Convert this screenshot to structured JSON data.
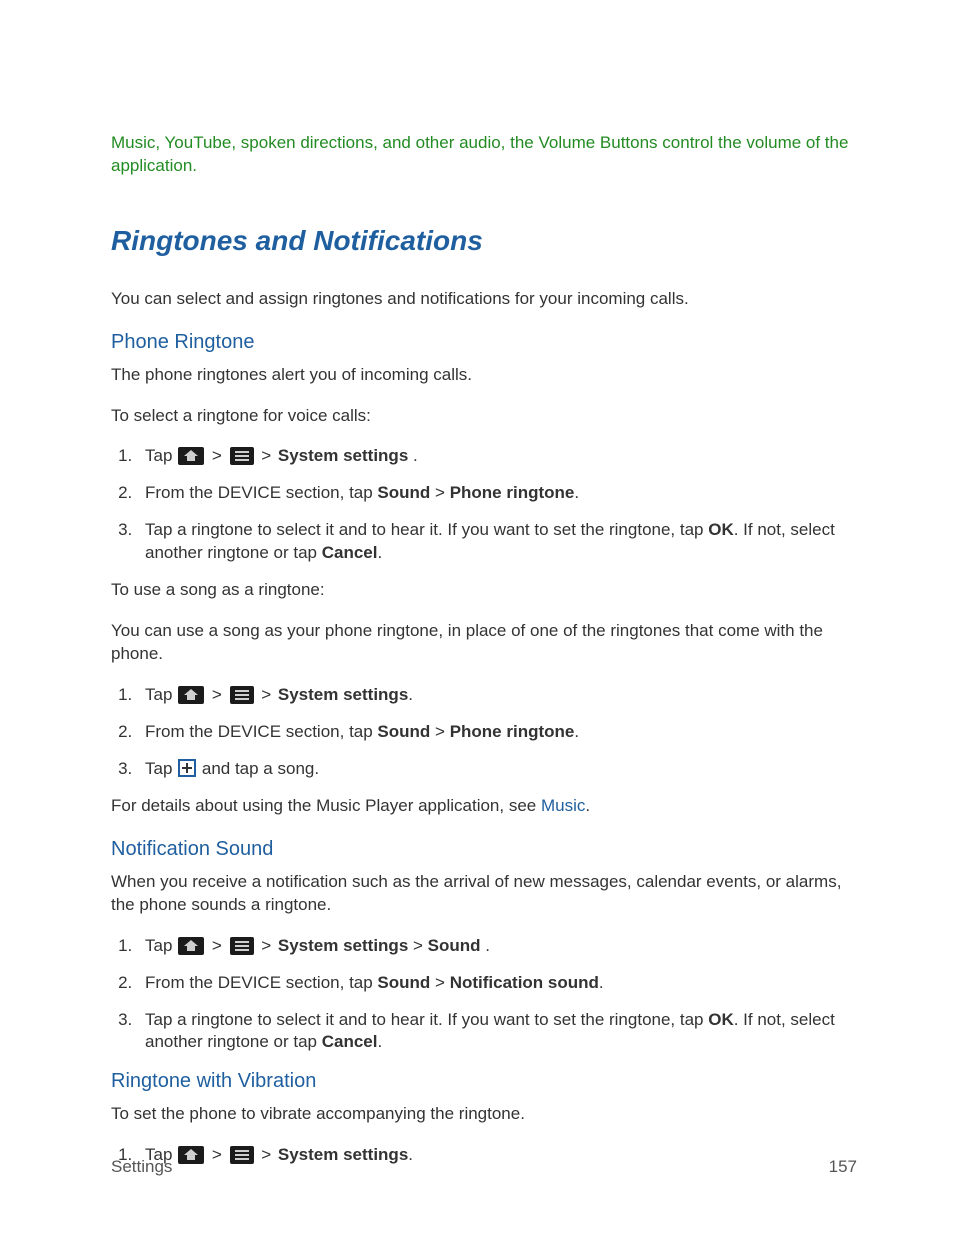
{
  "top_note": "Music, YouTube, spoken directions, and other audio, the Volume Buttons control the volume of the application.",
  "section_title": "Ringtones and Notifications",
  "section_intro": "You can select and assign ringtones and notifications for your incoming calls.",
  "phone_ringtone": {
    "title": "Phone Ringtone",
    "p1": "The phone ringtones alert you of incoming calls.",
    "p2": "To select a ringtone for voice calls:",
    "step1": {
      "tap": "Tap ",
      "sep": " > ",
      "system_settings": "System settings",
      "tail": " ."
    },
    "step2": {
      "lead": "From the DEVICE section, tap ",
      "sound": "Sound",
      "sep": " > ",
      "phone_ringtone": "Phone ringtone",
      "dot": "."
    },
    "step3": {
      "a": "Tap a ringtone to select it and to hear it. If you want to set the ringtone, tap ",
      "ok": "OK",
      "b": ". If not, select another ringtone or tap ",
      "cancel": "Cancel",
      "dot": "."
    },
    "p3": "To use a song as a ringtone:",
    "p4": "You can use a song as your phone ringtone, in place of one of the ringtones that come with the phone.",
    "step_b1": {
      "tap": "Tap ",
      "sep": " > ",
      "system_settings": "System settings",
      "dot": "."
    },
    "step_b2": {
      "lead": "From the DEVICE section, tap ",
      "sound": "Sound",
      "sep": " > ",
      "phone_ringtone": "Phone ringtone",
      "dot": "."
    },
    "step_b3": {
      "tap": "Tap ",
      "tail": " and tap a song."
    },
    "p5a": "For details about using the Music Player application, see ",
    "p5link": "Music",
    "p5dot": "."
  },
  "notification_sound": {
    "title": "Notification Sound",
    "p1": "When you receive a notification such as the arrival of new messages, calendar events, or alarms, the phone sounds a ringtone.",
    "step1": {
      "tap": "Tap ",
      "sep": " > ",
      "system_settings": "System settings",
      "sep2": " > ",
      "sound": "Sound",
      "tail": " ."
    },
    "step2": {
      "lead": "From the DEVICE section, tap ",
      "sound": "Sound",
      "sep": " > ",
      "notif": "Notification sound",
      "dot": "."
    },
    "step3": {
      "a": "Tap a ringtone to select it and to hear it. If you want to set the ringtone, tap ",
      "ok": "OK",
      "b": ". If not, select another ringtone or tap ",
      "cancel": "Cancel",
      "dot": "."
    }
  },
  "ringtone_vibration": {
    "title": "Ringtone with Vibration",
    "p1": "To set the phone to vibrate accompanying the ringtone.",
    "step1": {
      "tap": "Tap ",
      "sep": " > ",
      "system_settings": "System settings",
      "dot": "."
    }
  },
  "footer": {
    "left": "Settings",
    "right": "157"
  }
}
